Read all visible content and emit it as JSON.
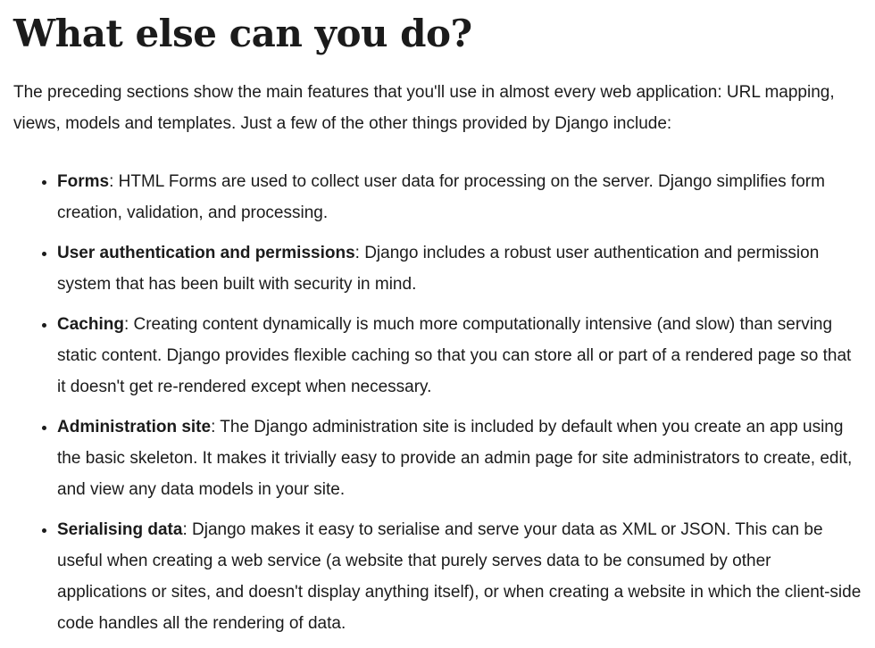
{
  "heading": "What else can you do?",
  "intro": "The preceding sections show the main features that you'll use in almost every web application: URL mapping, views, models and templates. Just a few of the other things provided by Django include:",
  "features": [
    {
      "term": "Forms",
      "description": ": HTML Forms are used to collect user data for processing on the server. Django simplifies form creation, validation, and processing."
    },
    {
      "term": "User authentication and permissions",
      "description": ": Django includes a robust user authentication and permission system that has been built with security in mind."
    },
    {
      "term": "Caching",
      "description": ": Creating content dynamically is much more computationally intensive (and slow) than serving static content. Django provides flexible caching so that you can store all or part of a rendered page so that it doesn't get re-rendered except when necessary."
    },
    {
      "term": "Administration site",
      "description": ": The Django administration site is included by default when you create an app using the basic skeleton. It makes it trivially easy to provide an admin page for site administrators to create, edit, and view any data models in your site."
    },
    {
      "term": "Serialising data",
      "description": ": Django makes it easy to serialise and serve your data as XML or JSON. This can be useful when creating a web service (a website that purely serves data to be consumed by other applications or sites, and doesn't display anything itself), or when creating a website in which the client-side code handles all the rendering of data."
    }
  ]
}
